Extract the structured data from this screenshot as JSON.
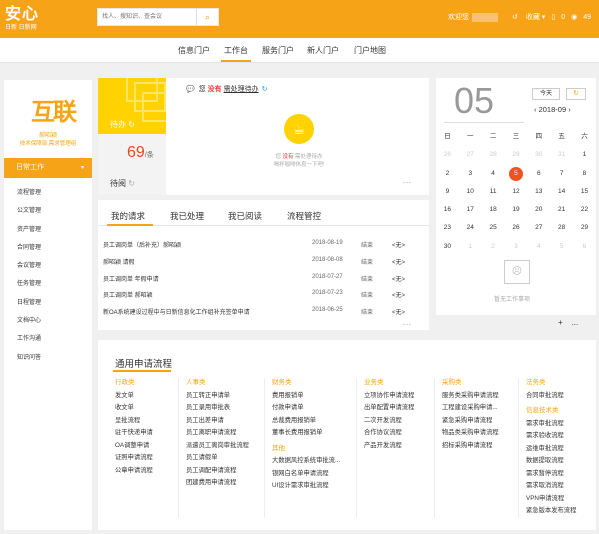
{
  "app": {
    "logo_main": "安心",
    "logo_sub": "日新 日新网"
  },
  "search": {
    "placeholder": "找人、搜知识、查会议"
  },
  "top_right": {
    "welcome": "欢迎您",
    "favorites": "收藏",
    "count1": "0",
    "count2": "49"
  },
  "nav": {
    "items": [
      "信息门户",
      "工作台",
      "服务门户",
      "新人门户",
      "门户地图"
    ],
    "active": "工作台"
  },
  "sidebar": {
    "avatar_text": "互联",
    "name": "郝昭颖",
    "dept": "技术保障部,需求管理组",
    "menu_title": "日常工作",
    "items": [
      "流程管理",
      "公文管理",
      "资产管理",
      "合同管理",
      "会议管理",
      "任务管理",
      "日程管理",
      "文档中心",
      "工作沟通",
      "知识问答"
    ]
  },
  "todo": {
    "pending_label": "待办",
    "count": "69",
    "unit": "/条",
    "read_label": "待阅",
    "msg_prefix": "您",
    "msg_none": "没有",
    "msg_link": "需处理待办",
    "empty_line1_a": "您",
    "empty_line1_b": "没有",
    "empty_line1_c": "需处理待办",
    "empty_line2": "喝杯咖啡休息一下吧!",
    "more": "..."
  },
  "tabs": {
    "items": [
      "我的请求",
      "我已处理",
      "我已阅读",
      "流程管控"
    ],
    "active": "我的请求",
    "rows": [
      {
        "title": "员工调岗单（后补充）郝昭颖",
        "date": "2018-08-19",
        "status": "结束",
        "src": "<无>"
      },
      {
        "title": "郝昭颖 请假",
        "date": "2018-08-08",
        "status": "结束",
        "src": "<无>"
      },
      {
        "title": "员工调岗单 年假申请",
        "date": "2018-07-27",
        "status": "结束",
        "src": "<无>"
      },
      {
        "title": "员工调岗单 郝昭颖",
        "date": "2018-07-23",
        "status": "结束",
        "src": "<无>"
      },
      {
        "title": "新OA系统建设过程中与日新信息化工作组补充签单申请",
        "date": "2018-06-25",
        "status": "结束",
        "src": "<无>"
      }
    ],
    "more": "..."
  },
  "calendar": {
    "day": "05",
    "today_label": "今天",
    "month": "2018-09",
    "weekdays": [
      "日",
      "一",
      "二",
      "三",
      "四",
      "五",
      "六"
    ],
    "weeks": [
      [
        {
          "d": "26",
          "t": "prev"
        },
        {
          "d": "27",
          "t": "prev"
        },
        {
          "d": "28",
          "t": "prev"
        },
        {
          "d": "29",
          "t": "prev"
        },
        {
          "d": "30",
          "t": "prev"
        },
        {
          "d": "31",
          "t": "prev"
        },
        {
          "d": "1",
          "t": ""
        }
      ],
      [
        {
          "d": "2",
          "t": ""
        },
        {
          "d": "3",
          "t": ""
        },
        {
          "d": "4",
          "t": ""
        },
        {
          "d": "5",
          "t": "sel"
        },
        {
          "d": "6",
          "t": ""
        },
        {
          "d": "7",
          "t": ""
        },
        {
          "d": "8",
          "t": ""
        }
      ],
      [
        {
          "d": "9",
          "t": ""
        },
        {
          "d": "10",
          "t": ""
        },
        {
          "d": "11",
          "t": ""
        },
        {
          "d": "12",
          "t": ""
        },
        {
          "d": "13",
          "t": ""
        },
        {
          "d": "14",
          "t": ""
        },
        {
          "d": "15",
          "t": ""
        }
      ],
      [
        {
          "d": "16",
          "t": ""
        },
        {
          "d": "17",
          "t": ""
        },
        {
          "d": "18",
          "t": ""
        },
        {
          "d": "19",
          "t": ""
        },
        {
          "d": "20",
          "t": ""
        },
        {
          "d": "21",
          "t": ""
        },
        {
          "d": "22",
          "t": ""
        }
      ],
      [
        {
          "d": "23",
          "t": ""
        },
        {
          "d": "24",
          "t": ""
        },
        {
          "d": "25",
          "t": ""
        },
        {
          "d": "26",
          "t": ""
        },
        {
          "d": "27",
          "t": ""
        },
        {
          "d": "28",
          "t": ""
        },
        {
          "d": "29",
          "t": ""
        }
      ],
      [
        {
          "d": "30",
          "t": ""
        },
        {
          "d": "1",
          "t": "next"
        },
        {
          "d": "2",
          "t": "next"
        },
        {
          "d": "3",
          "t": "next"
        },
        {
          "d": "4",
          "t": "next"
        },
        {
          "d": "5",
          "t": "next"
        },
        {
          "d": "6",
          "t": "next"
        }
      ]
    ],
    "empty_text": "暂无工作事项",
    "add": "+",
    "more": "..."
  },
  "flows": {
    "title": "通用申请流程",
    "columns": [
      {
        "head": "行政类",
        "items": [
          "发文单",
          "收文单",
          "呈批流程",
          "驻干快递申请",
          "OA调整申请",
          "证照申请流程",
          "公章申请流程"
        ]
      },
      {
        "head": "人事类",
        "items": [
          "员工转正申请单",
          "员工录用审批表",
          "员工出差申请",
          "员工离职申请流程",
          "派遣员工离岗审批流程",
          "员工请假单",
          "员工调配申请流程",
          "团建费用申请流程"
        ]
      },
      {
        "head": "财务类",
        "items": [
          "费用报销单",
          "付款申请单",
          "总裁费用报销单",
          "董事长费用报销单"
        ],
        "head2": "其他",
        "items2": [
          "大数据风控系统审批流...",
          "银网白名单申请流程",
          "UI设计需求审批流程"
        ]
      },
      {
        "head": "业务类",
        "items": [
          "立项协作申请流程",
          "出单配置申请流程",
          "二次开发流程",
          "合作协议流程",
          "产品开发流程"
        ]
      },
      {
        "head": "采购类",
        "items": [
          "服务类采购申请流程",
          "工程建设采购申请...",
          "紧急采购申请流程",
          "物品类采购申请流程",
          "招标采购申请流程"
        ]
      },
      {
        "head": "法务类",
        "items": [
          "合同审批流程"
        ],
        "head2": "信息技术类",
        "items2": [
          "需求审批流程",
          "需求验收流程",
          "运维审批流程",
          "数据提取流程",
          "需求暂停流程",
          "需求取消流程",
          "VPN申请流程",
          "紧急版本发布流程"
        ]
      }
    ]
  }
}
